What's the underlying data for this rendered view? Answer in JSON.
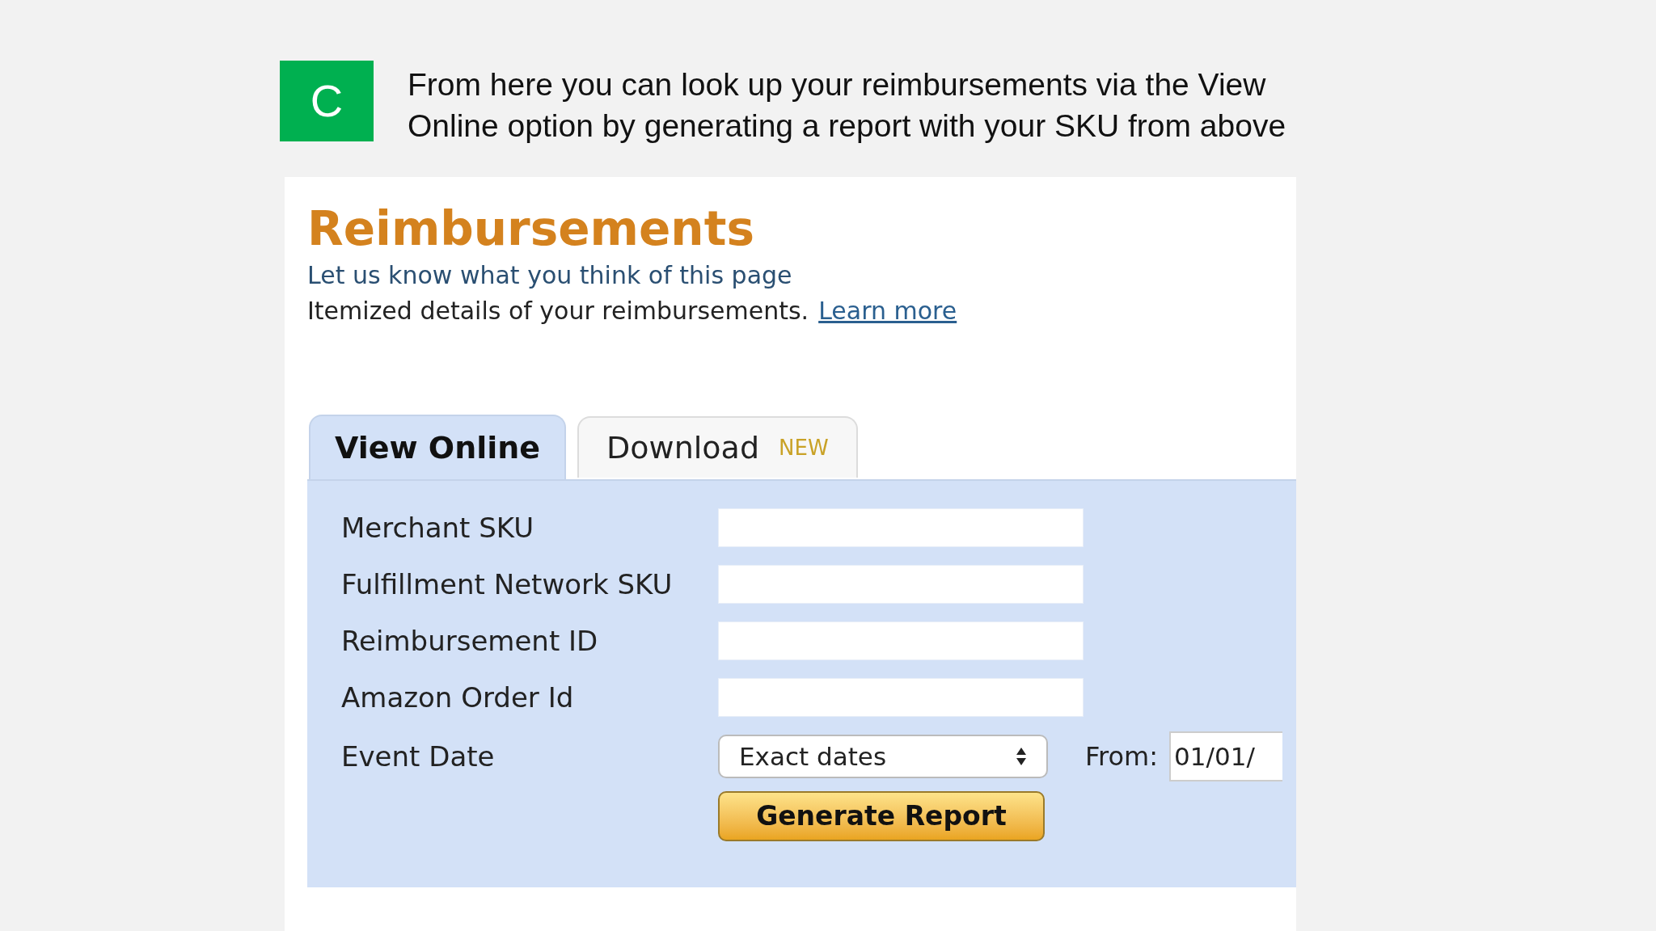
{
  "slide": {
    "badge": "C",
    "caption": "From here you can look up your reimbursements via the View Online option by generating a report with your SKU from above"
  },
  "page": {
    "title": "Reimbursements",
    "feedback_link": "Let us know what you think of this page",
    "description": "Itemized details of your reimbursements.",
    "learn_more": "Learn more"
  },
  "tabs": [
    {
      "label": "View Online",
      "selected": true
    },
    {
      "label": "Download",
      "badge": "NEW",
      "selected": false
    }
  ],
  "form": {
    "fields": [
      {
        "kind": "text",
        "label": "Merchant SKU"
      },
      {
        "kind": "text",
        "label": "Fulfillment Network SKU"
      },
      {
        "kind": "text",
        "label": "Reimbursement ID"
      },
      {
        "kind": "text",
        "label": "Amazon Order Id"
      },
      {
        "kind": "date",
        "label": "Event Date",
        "select_value": "Exact dates",
        "from_label": "From:",
        "from_value": "01/01/"
      }
    ],
    "button": "Generate Report"
  }
}
